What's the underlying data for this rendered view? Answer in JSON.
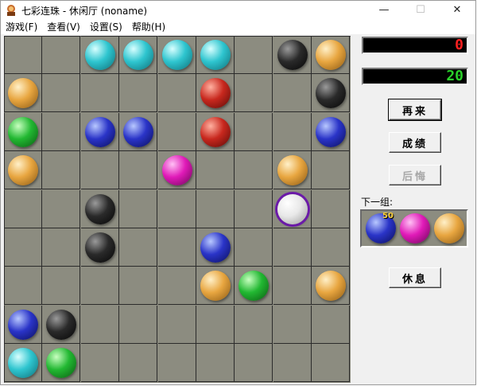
{
  "window": {
    "title": "七彩连珠 - 休闲厅  (noname)",
    "controls": {
      "minimize": "—",
      "maximize": "☐",
      "close": "✕"
    }
  },
  "menu": [
    "游戏(F)",
    "查看(V)",
    "设置(S)",
    "帮助(H)"
  ],
  "board": {
    "rows": 9,
    "cols": 9,
    "cells": [
      [
        null,
        null,
        "cyan",
        "cyan",
        "cyan",
        "cyan",
        null,
        "black",
        "orange"
      ],
      [
        "orange",
        null,
        null,
        null,
        null,
        "red",
        null,
        null,
        "black"
      ],
      [
        "green",
        null,
        "blue",
        "blue",
        null,
        "red",
        null,
        null,
        "blue"
      ],
      [
        "orange",
        null,
        null,
        null,
        "magenta",
        null,
        null,
        "orange",
        null
      ],
      [
        null,
        null,
        "black",
        null,
        null,
        null,
        null,
        "white",
        null
      ],
      [
        null,
        null,
        "black",
        null,
        null,
        "blue",
        null,
        null,
        null
      ],
      [
        null,
        null,
        null,
        null,
        null,
        "orange",
        "green",
        null,
        "orange"
      ],
      [
        "blue",
        "black",
        null,
        null,
        null,
        null,
        null,
        null,
        null
      ],
      [
        "cyan",
        "green",
        null,
        null,
        null,
        null,
        null,
        null,
        null
      ]
    ],
    "selected": [
      4,
      7
    ]
  },
  "score": {
    "value": "0",
    "color": "#ff2020"
  },
  "level": {
    "value": "20",
    "color": "#2ad02a"
  },
  "buttons": {
    "restart": "再来",
    "scores": "成绩",
    "undo": "后悔",
    "pause": "休息"
  },
  "next": {
    "label": "下一组:",
    "count": "50",
    "balls": [
      "blue",
      "magenta",
      "orange"
    ]
  },
  "palette": {
    "cyan": [
      "#d8ffff",
      "#2ec5cf",
      "#0e6f78"
    ],
    "black": [
      "#9a9a9a",
      "#2a2a2a",
      "#050505"
    ],
    "orange": [
      "#fff0c8",
      "#e8a640",
      "#8a5812"
    ],
    "red": [
      "#ffb0a0",
      "#c8281e",
      "#5a0a06"
    ],
    "green": [
      "#c8ffc0",
      "#22b832",
      "#0a5a10"
    ],
    "blue": [
      "#b8c8ff",
      "#2a34c8",
      "#0a0e5a"
    ],
    "magenta": [
      "#ffc0f4",
      "#e01ab8",
      "#6a0656"
    ],
    "white": [
      "#ffffff",
      "#e8e8e8",
      "#9a9a9a"
    ]
  }
}
